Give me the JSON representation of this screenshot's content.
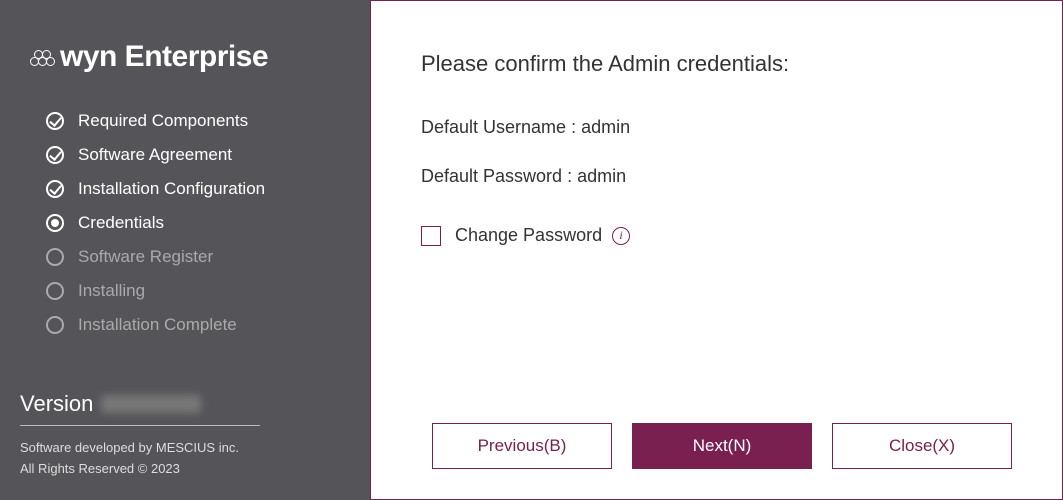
{
  "brand": "wyn Enterprise",
  "steps": [
    {
      "label": "Required Components",
      "state": "done"
    },
    {
      "label": "Software Agreement",
      "state": "done"
    },
    {
      "label": "Installation Configuration",
      "state": "done"
    },
    {
      "label": "Credentials",
      "state": "current"
    },
    {
      "label": "Software Register",
      "state": "pending"
    },
    {
      "label": "Installing",
      "state": "pending"
    },
    {
      "label": "Installation Complete",
      "state": "pending"
    }
  ],
  "sidebar": {
    "version_label": "Version",
    "developer_line": "Software developed by MESCIUS inc.",
    "rights_line": "All Rights Reserved © 2023"
  },
  "main": {
    "heading": "Please confirm the Admin credentials:",
    "username_line": "Default Username : admin",
    "password_line": "Default Password : admin",
    "change_password_label": "Change Password"
  },
  "buttons": {
    "previous": "Previous(B)",
    "next": "Next(N)",
    "close": "Close(X)"
  }
}
